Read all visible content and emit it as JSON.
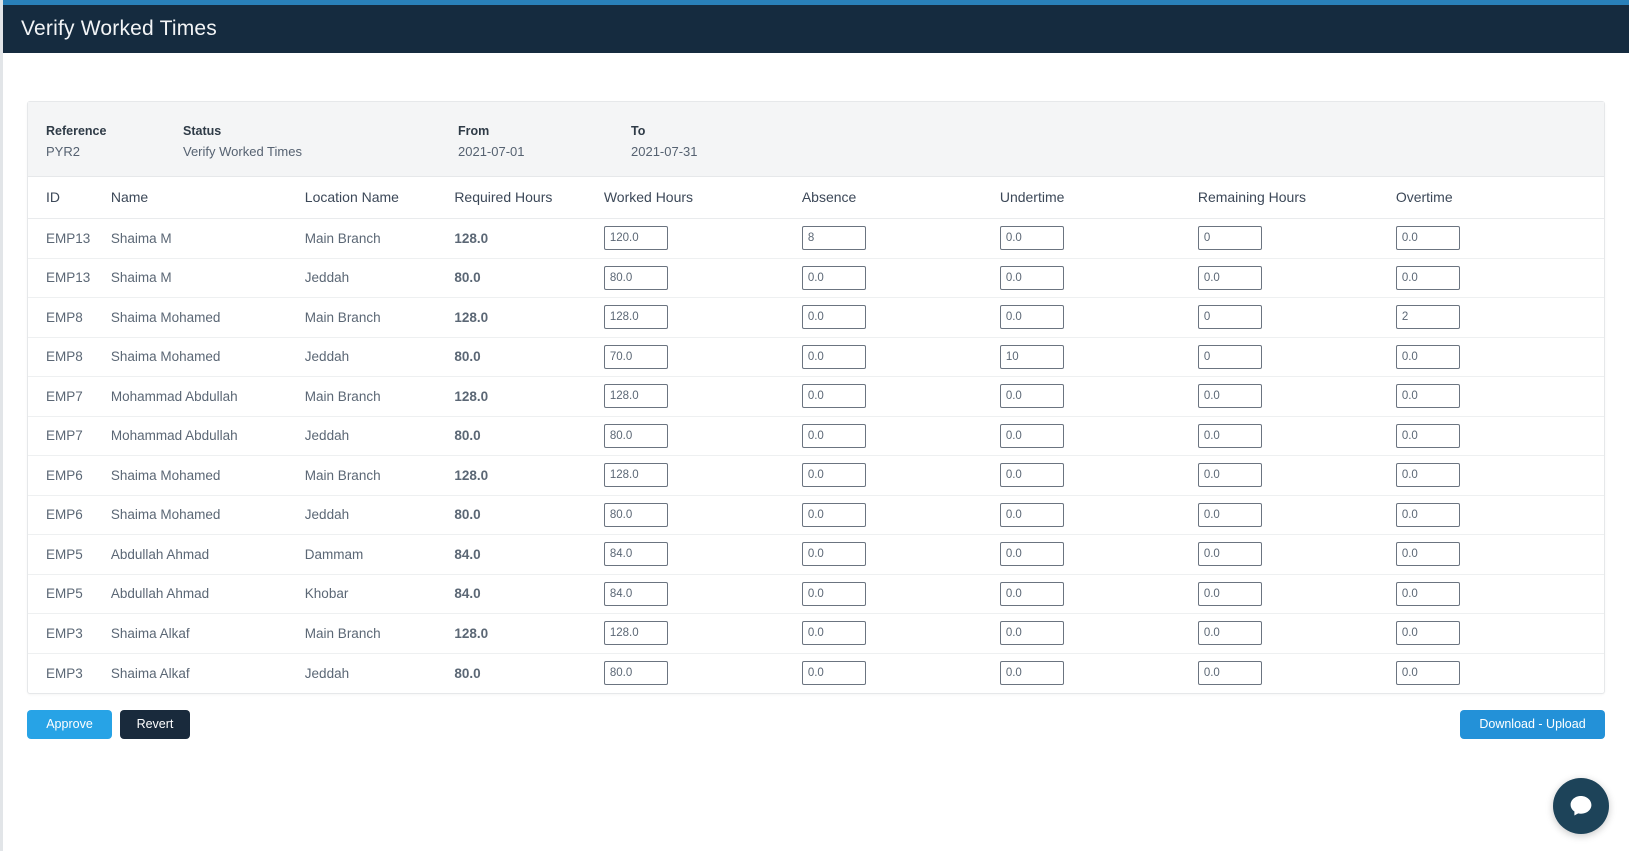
{
  "theme": {
    "accent_top": "#2980b9",
    "header_bg": "#152b3f",
    "approve_blue": "#27a3e6",
    "revert_dark": "#192a3c",
    "download_blue": "#2391d8",
    "chat_navy": "#1d4359"
  },
  "header": {
    "title": "Verify Worked Times"
  },
  "summary": {
    "reference_label": "Reference",
    "reference_value": "PYR2",
    "status_label": "Status",
    "status_value": "Verify Worked Times",
    "from_label": "From",
    "from_value": "2021-07-01",
    "to_label": "To",
    "to_value": "2021-07-31"
  },
  "table": {
    "columns": [
      "ID",
      "Name",
      "Location Name",
      "Required Hours",
      "Worked Hours",
      "Absence",
      "Undertime",
      "Remaining Hours",
      "Overtime"
    ],
    "rows": [
      {
        "id": "EMP13",
        "name": "Shaima M",
        "location": "Main Branch",
        "required": "128.0",
        "worked": "120.0",
        "absence": "8",
        "undertime": "0.0",
        "remaining": "0",
        "overtime": "0.0"
      },
      {
        "id": "EMP13",
        "name": "Shaima M",
        "location": "Jeddah",
        "required": "80.0",
        "worked": "80.0",
        "absence": "0.0",
        "undertime": "0.0",
        "remaining": "0.0",
        "overtime": "0.0"
      },
      {
        "id": "EMP8",
        "name": "Shaima Mohamed",
        "location": "Main Branch",
        "required": "128.0",
        "worked": "128.0",
        "absence": "0.0",
        "undertime": "0.0",
        "remaining": "0",
        "overtime": "2"
      },
      {
        "id": "EMP8",
        "name": "Shaima Mohamed",
        "location": "Jeddah",
        "required": "80.0",
        "worked": "70.0",
        "absence": "0.0",
        "undertime": "10",
        "remaining": "0",
        "overtime": "0.0"
      },
      {
        "id": "EMP7",
        "name": "Mohammad Abdullah",
        "location": "Main Branch",
        "required": "128.0",
        "worked": "128.0",
        "absence": "0.0",
        "undertime": "0.0",
        "remaining": "0.0",
        "overtime": "0.0"
      },
      {
        "id": "EMP7",
        "name": "Mohammad Abdullah",
        "location": "Jeddah",
        "required": "80.0",
        "worked": "80.0",
        "absence": "0.0",
        "undertime": "0.0",
        "remaining": "0.0",
        "overtime": "0.0"
      },
      {
        "id": "EMP6",
        "name": "Shaima Mohamed",
        "location": "Main Branch",
        "required": "128.0",
        "worked": "128.0",
        "absence": "0.0",
        "undertime": "0.0",
        "remaining": "0.0",
        "overtime": "0.0"
      },
      {
        "id": "EMP6",
        "name": "Shaima Mohamed",
        "location": "Jeddah",
        "required": "80.0",
        "worked": "80.0",
        "absence": "0.0",
        "undertime": "0.0",
        "remaining": "0.0",
        "overtime": "0.0"
      },
      {
        "id": "EMP5",
        "name": "Abdullah Ahmad",
        "location": "Dammam",
        "required": "84.0",
        "worked": "84.0",
        "absence": "0.0",
        "undertime": "0.0",
        "remaining": "0.0",
        "overtime": "0.0"
      },
      {
        "id": "EMP5",
        "name": "Abdullah Ahmad",
        "location": "Khobar",
        "required": "84.0",
        "worked": "84.0",
        "absence": "0.0",
        "undertime": "0.0",
        "remaining": "0.0",
        "overtime": "0.0"
      },
      {
        "id": "EMP3",
        "name": "Shaima Alkaf",
        "location": "Main Branch",
        "required": "128.0",
        "worked": "128.0",
        "absence": "0.0",
        "undertime": "0.0",
        "remaining": "0.0",
        "overtime": "0.0"
      },
      {
        "id": "EMP3",
        "name": "Shaima Alkaf",
        "location": "Jeddah",
        "required": "80.0",
        "worked": "80.0",
        "absence": "0.0",
        "undertime": "0.0",
        "remaining": "0.0",
        "overtime": "0.0"
      }
    ]
  },
  "actions": {
    "approve_label": "Approve",
    "revert_label": "Revert",
    "download_label": "Download - Upload"
  },
  "chat": {
    "icon": "chat-bubble-icon"
  }
}
